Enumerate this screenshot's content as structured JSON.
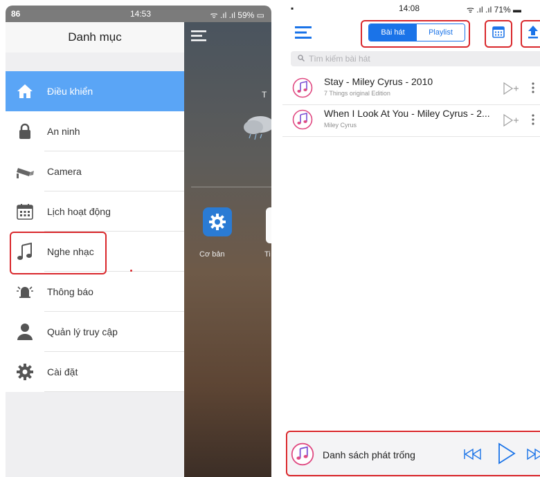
{
  "left_screen": {
    "status": {
      "left": "86",
      "time": "14:53",
      "right": "59%"
    },
    "drawer_title": "Danh mục",
    "menu_items": [
      {
        "label": "Điều khiển",
        "icon": "home-icon",
        "active": true
      },
      {
        "label": "An ninh",
        "icon": "lock-icon",
        "active": false
      },
      {
        "label": "Camera",
        "icon": "camera-icon",
        "active": false
      },
      {
        "label": "Lịch hoạt động",
        "icon": "calendar-icon",
        "active": false
      },
      {
        "label": "Nghe nhạc",
        "icon": "music-note-icon",
        "active": false
      },
      {
        "label": "Thông báo",
        "icon": "bell-icon",
        "active": false
      },
      {
        "label": "Quản lý truy cập",
        "icon": "user-icon",
        "active": false
      },
      {
        "label": "Cài đặt",
        "icon": "gear-icon",
        "active": false
      }
    ],
    "background": {
      "edge_text": "T",
      "tile_label": "Cơ bản",
      "next_tile_label": "Ti"
    }
  },
  "right_screen": {
    "status": {
      "time": "14:08",
      "right": "71%"
    },
    "tabs": [
      {
        "label": "Bài hát",
        "selected": true
      },
      {
        "label": "Playlist",
        "selected": false
      }
    ],
    "search": {
      "placeholder": "Tìm kiếm bài hát"
    },
    "songs": [
      {
        "title": "Stay - Miley Cyrus - 2010",
        "artist": "7 Things original Edition"
      },
      {
        "title": "When I Look At You - Miley Cyrus - 2...",
        "artist": "Miley Cyrus"
      }
    ],
    "player": {
      "text": "Danh sách phát trống"
    }
  },
  "colors": {
    "accent": "#1a73e8",
    "active_menu": "#5aa5f6",
    "highlight": "#d9262a"
  }
}
